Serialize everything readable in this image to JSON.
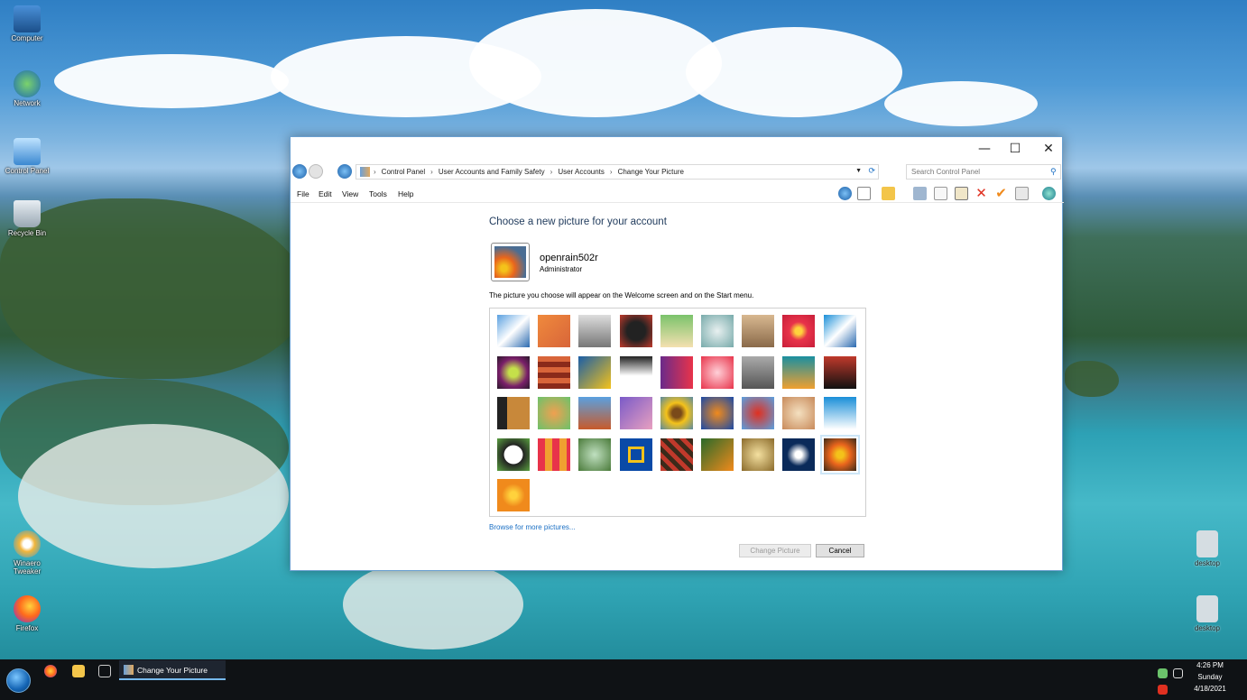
{
  "desktop": {
    "icons": [
      {
        "label": "Computer"
      },
      {
        "label": "Network"
      },
      {
        "label": "Control Panel"
      },
      {
        "label": "Recycle Bin"
      },
      {
        "label": "Winaero Tweaker"
      },
      {
        "label": "Firefox"
      },
      {
        "label": "desktop"
      },
      {
        "label": "desktop"
      }
    ]
  },
  "window": {
    "caption_buttons": {
      "minimize": "—",
      "maximize": "☐",
      "close": "✕"
    },
    "breadcrumb": [
      "Control Panel",
      "User Accounts and Family Safety",
      "User Accounts",
      "Change Your Picture"
    ],
    "breadcrumb_sep": "›",
    "search_placeholder": "Search Control Panel",
    "menu": [
      "File",
      "Edit",
      "View",
      "Tools",
      "Help"
    ],
    "heading": "Choose a new picture for your account",
    "user": {
      "name": "openrain502r",
      "role": "Administrator"
    },
    "hint": "The picture you choose will appear on the Welcome screen and on the Start menu.",
    "browse_link": "Browse for more pictures...",
    "buttons": {
      "change": "Change Picture",
      "cancel": "Cancel"
    },
    "selected_picture_index": 35
  },
  "taskbar": {
    "task_label": "Change Your Picture",
    "clock": {
      "time": "4:26 PM",
      "day": "Sunday",
      "date": "4/18/2021"
    }
  }
}
